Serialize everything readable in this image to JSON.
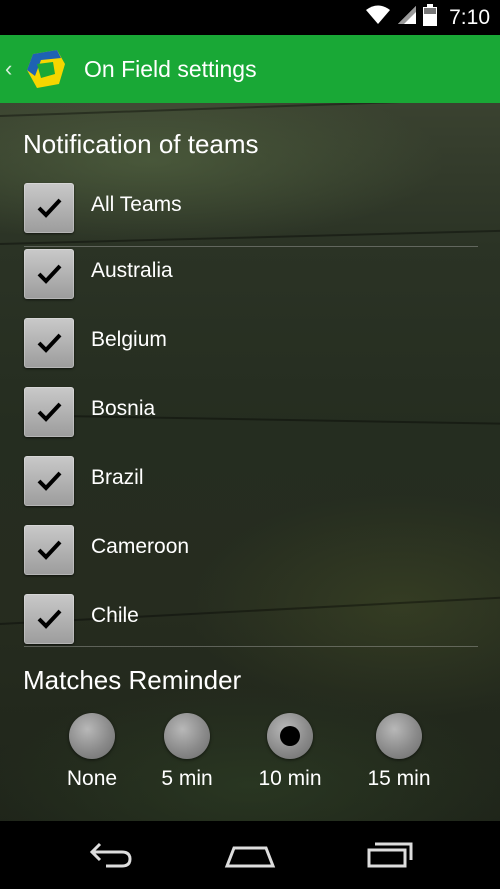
{
  "status_bar": {
    "time": "7:10",
    "icons": [
      "wifi-icon",
      "signal-icon",
      "battery-icon"
    ]
  },
  "action_bar": {
    "title": "On Field settings",
    "back_icon": "chevron-left-icon",
    "logo_icon": "app-logo-icon",
    "background": "#19a836"
  },
  "notifications": {
    "title": "Notification of teams",
    "teams": [
      {
        "label": "All Teams",
        "checked": true
      },
      {
        "label": "Australia",
        "checked": true
      },
      {
        "label": "Belgium",
        "checked": true
      },
      {
        "label": "Bosnia",
        "checked": true
      },
      {
        "label": "Brazil",
        "checked": true
      },
      {
        "label": "Cameroon",
        "checked": true
      },
      {
        "label": "Chile",
        "checked": true
      }
    ]
  },
  "reminder": {
    "title": "Matches Reminder",
    "options": [
      {
        "label": "None",
        "selected": false
      },
      {
        "label": "5 min",
        "selected": false
      },
      {
        "label": "10 min",
        "selected": true
      },
      {
        "label": "15 min",
        "selected": false
      }
    ]
  },
  "nav_bar": {
    "buttons": [
      "back-nav-icon",
      "home-nav-icon",
      "recents-nav-icon"
    ]
  }
}
